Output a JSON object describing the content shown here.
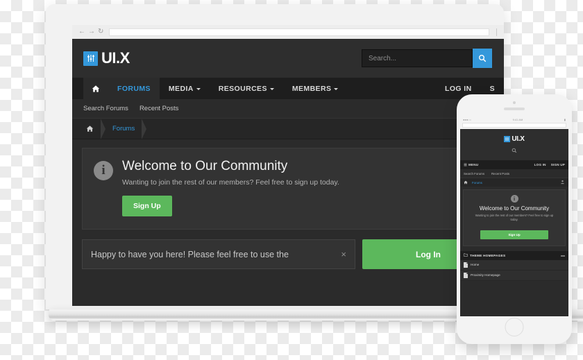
{
  "browser": {
    "back_icon": "back-arrow-icon",
    "forward_icon": "forward-arrow-icon",
    "reload_icon": "reload-icon",
    "url_value": ""
  },
  "site": {
    "logo": {
      "mark_icon": "equalizer-sliders-icon",
      "text": "UI.X",
      "accent": "#3498db"
    },
    "search": {
      "placeholder": "Search...",
      "value": "",
      "button_icon": "search-icon",
      "button_color": "#3498db"
    },
    "nav": {
      "home_icon": "home-icon",
      "items": [
        {
          "label": "FORUMS",
          "has_caret": false,
          "active": true
        },
        {
          "label": "MEDIA",
          "has_caret": true,
          "active": false
        },
        {
          "label": "RESOURCES",
          "has_caret": true,
          "active": false
        },
        {
          "label": "MEMBERS",
          "has_caret": true,
          "active": false
        }
      ],
      "right": [
        {
          "label": "LOG IN"
        },
        {
          "label": "S"
        }
      ]
    },
    "subnav": [
      {
        "label": "Search Forums"
      },
      {
        "label": "Recent Posts"
      }
    ],
    "breadcrumb": {
      "home_icon": "home-icon",
      "items": [
        {
          "label": "Forums"
        }
      ],
      "right_icon": "user-upload-icon"
    },
    "welcome": {
      "icon": "info-circle-icon",
      "title": "Welcome to Our Community",
      "subtitle": "Wanting to join the rest of our members? Feel free to sign up today.",
      "button_label": "Sign Up",
      "button_color": "#5cb85c"
    },
    "notice": {
      "text": "Happy to have you here! Please feel free to use the",
      "close_icon": "close-icon"
    },
    "login_button": {
      "label": "Log In",
      "color": "#5cb85c"
    }
  },
  "phone": {
    "status": {
      "left": "●●●○○",
      "center": "9:41 AM",
      "right": "▮"
    },
    "logo": {
      "mark_icon": "equalizer-sliders-icon",
      "text": "UI.X"
    },
    "search_icon": "search-icon",
    "nav": {
      "menu_icon": "hamburger-menu-icon",
      "menu_label": "MENU",
      "right": [
        {
          "label": "LOG IN"
        },
        {
          "label": "SIGN UP"
        }
      ]
    },
    "subnav": [
      {
        "label": "Search Forums"
      },
      {
        "label": "Recent Posts"
      }
    ],
    "breadcrumb": {
      "home_icon": "home-icon",
      "items": [
        {
          "label": "Forums"
        }
      ],
      "right_icon": "user-upload-icon"
    },
    "welcome": {
      "icon": "info-circle-icon",
      "title": "Welcome to Our Community",
      "subtitle": "Wanting to join the rest of our members? Feel free to sign up today.",
      "button_label": "Sign Up"
    },
    "section": {
      "folder_icon": "folder-icon",
      "title": "THEME HOMEPAGES",
      "collapse_icon": "minus-icon",
      "rows": [
        {
          "icon": "document-icon",
          "label": "Home"
        },
        {
          "icon": "document-icon",
          "label": "Proximity Homepage"
        }
      ]
    }
  }
}
